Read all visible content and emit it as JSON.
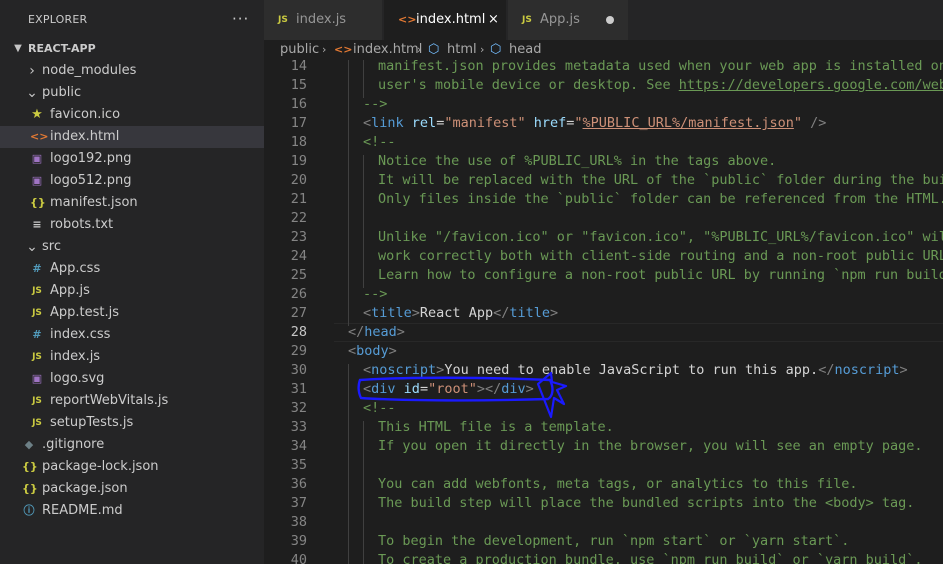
{
  "sidebar": {
    "title": "EXPLORER",
    "more": "···",
    "root": "REACT-APP",
    "items": [
      {
        "label": "node_modules",
        "icon": "chevron-right",
        "depth": 1
      },
      {
        "label": "public",
        "icon": "chevron-down",
        "depth": 1
      },
      {
        "label": "favicon.ico",
        "icon": "star-icon",
        "depth": 2
      },
      {
        "label": "index.html",
        "icon": "html-icon",
        "depth": 2,
        "selected": true
      },
      {
        "label": "logo192.png",
        "icon": "image-icon",
        "depth": 2
      },
      {
        "label": "logo512.png",
        "icon": "image-icon",
        "depth": 2
      },
      {
        "label": "manifest.json",
        "icon": "json-icon",
        "depth": 2
      },
      {
        "label": "robots.txt",
        "icon": "text-icon",
        "depth": 2
      },
      {
        "label": "src",
        "icon": "chevron-down",
        "depth": 1
      },
      {
        "label": "App.css",
        "icon": "css-icon",
        "depth": 2
      },
      {
        "label": "App.js",
        "icon": "js-icon",
        "depth": 2
      },
      {
        "label": "App.test.js",
        "icon": "js-icon",
        "depth": 2
      },
      {
        "label": "index.css",
        "icon": "css-icon",
        "depth": 2
      },
      {
        "label": "index.js",
        "icon": "js-icon",
        "depth": 2
      },
      {
        "label": "logo.svg",
        "icon": "image-icon",
        "depth": 2
      },
      {
        "label": "reportWebVitals.js",
        "icon": "js-icon",
        "depth": 2
      },
      {
        "label": "setupTests.js",
        "icon": "js-icon",
        "depth": 2
      },
      {
        "label": ".gitignore",
        "icon": "git-icon",
        "depth": 1
      },
      {
        "label": "package-lock.json",
        "icon": "json-icon",
        "depth": 1
      },
      {
        "label": "package.json",
        "icon": "json-icon",
        "depth": 1
      },
      {
        "label": "README.md",
        "icon": "info-icon",
        "depth": 1
      }
    ]
  },
  "tabs": [
    {
      "label": "index.js",
      "icon_text": "JS"
    },
    {
      "label": "index.html",
      "icon_text": "<>",
      "active": true,
      "close": "×"
    },
    {
      "label": "App.js",
      "icon_text": "JS",
      "modified": true
    }
  ],
  "breadcrumb": {
    "folder": "public",
    "file": "index.html",
    "node1": "html",
    "node2": "head"
  },
  "editor": {
    "current_line": 28,
    "lines": [
      {
        "n": 14,
        "indent": 2,
        "tokens": [
          {
            "t": "c",
            "v": "manifest.json provides metadata used when your web app is installed on a"
          }
        ]
      },
      {
        "n": 15,
        "indent": 2,
        "tokens": [
          {
            "t": "c",
            "v": "user's mobile device or desktop. See "
          },
          {
            "t": "cu",
            "v": "https://developers.google.com/web/fundamentals/web-app-manifest/"
          }
        ]
      },
      {
        "n": 16,
        "indent": 1,
        "tokens": [
          {
            "t": "c",
            "v": "-->"
          }
        ]
      },
      {
        "n": 17,
        "indent": 1,
        "tokens": [
          {
            "t": "p",
            "v": "<"
          },
          {
            "t": "tag",
            "v": "link"
          },
          {
            "t": "x",
            "v": " "
          },
          {
            "t": "a",
            "v": "rel"
          },
          {
            "t": "x",
            "v": "="
          },
          {
            "t": "s",
            "v": "\"manifest\""
          },
          {
            "t": "x",
            "v": " "
          },
          {
            "t": "a",
            "v": "href"
          },
          {
            "t": "x",
            "v": "="
          },
          {
            "t": "s",
            "v": "\""
          },
          {
            "t": "su",
            "v": "%PUBLIC_URL%/manifest.json"
          },
          {
            "t": "s",
            "v": "\""
          },
          {
            "t": "x",
            "v": " "
          },
          {
            "t": "p",
            "v": "/>"
          }
        ]
      },
      {
        "n": 18,
        "indent": 1,
        "tokens": [
          {
            "t": "c",
            "v": "<!--"
          }
        ]
      },
      {
        "n": 19,
        "indent": 2,
        "tokens": [
          {
            "t": "c",
            "v": "Notice the use of %PUBLIC_URL% in the tags above."
          }
        ]
      },
      {
        "n": 20,
        "indent": 2,
        "tokens": [
          {
            "t": "c",
            "v": "It will be replaced with the URL of the `public` folder during the build."
          }
        ]
      },
      {
        "n": 21,
        "indent": 2,
        "tokens": [
          {
            "t": "c",
            "v": "Only files inside the `public` folder can be referenced from the HTML."
          }
        ]
      },
      {
        "n": 22,
        "indent": 2,
        "tokens": []
      },
      {
        "n": 23,
        "indent": 2,
        "tokens": [
          {
            "t": "c",
            "v": "Unlike \"/favicon.ico\" or \"favicon.ico\", \"%PUBLIC_URL%/favicon.ico\" will"
          }
        ]
      },
      {
        "n": 24,
        "indent": 2,
        "tokens": [
          {
            "t": "c",
            "v": "work correctly both with client-side routing and a non-root public URL."
          }
        ]
      },
      {
        "n": 25,
        "indent": 2,
        "tokens": [
          {
            "t": "c",
            "v": "Learn how to configure a non-root public URL by running `npm run build`."
          }
        ]
      },
      {
        "n": 26,
        "indent": 1,
        "tokens": [
          {
            "t": "c",
            "v": "-->"
          }
        ]
      },
      {
        "n": 27,
        "indent": 1,
        "tokens": [
          {
            "t": "p",
            "v": "<"
          },
          {
            "t": "tag",
            "v": "title"
          },
          {
            "t": "p",
            "v": ">"
          },
          {
            "t": "x",
            "v": "React App"
          },
          {
            "t": "p",
            "v": "</"
          },
          {
            "t": "tag",
            "v": "title"
          },
          {
            "t": "p",
            "v": ">"
          }
        ]
      },
      {
        "n": 28,
        "indent": 0,
        "tokens": [
          {
            "t": "p",
            "v": "</"
          },
          {
            "t": "tag",
            "v": "head"
          },
          {
            "t": "p",
            "v": ">"
          }
        ]
      },
      {
        "n": 29,
        "indent": 0,
        "tokens": [
          {
            "t": "p",
            "v": "<"
          },
          {
            "t": "tag",
            "v": "body"
          },
          {
            "t": "p",
            "v": ">"
          }
        ]
      },
      {
        "n": 30,
        "indent": 1,
        "tokens": [
          {
            "t": "p",
            "v": "<"
          },
          {
            "t": "tag",
            "v": "noscript"
          },
          {
            "t": "p",
            "v": ">"
          },
          {
            "t": "x",
            "v": "You need to enable JavaScript to run this app."
          },
          {
            "t": "p",
            "v": "</"
          },
          {
            "t": "tag",
            "v": "noscript"
          },
          {
            "t": "p",
            "v": ">"
          }
        ]
      },
      {
        "n": 31,
        "indent": 1,
        "tokens": [
          {
            "t": "p",
            "v": "<"
          },
          {
            "t": "tag",
            "v": "div"
          },
          {
            "t": "x",
            "v": " "
          },
          {
            "t": "a",
            "v": "id"
          },
          {
            "t": "x",
            "v": "="
          },
          {
            "t": "s",
            "v": "\"root\""
          },
          {
            "t": "p",
            "v": "></"
          },
          {
            "t": "tag",
            "v": "div"
          },
          {
            "t": "p",
            "v": ">"
          }
        ]
      },
      {
        "n": 32,
        "indent": 1,
        "tokens": [
          {
            "t": "c",
            "v": "<!--"
          }
        ]
      },
      {
        "n": 33,
        "indent": 2,
        "tokens": [
          {
            "t": "c",
            "v": "This HTML file is a template."
          }
        ]
      },
      {
        "n": 34,
        "indent": 2,
        "tokens": [
          {
            "t": "c",
            "v": "If you open it directly in the browser, you will see an empty page."
          }
        ]
      },
      {
        "n": 35,
        "indent": 2,
        "tokens": []
      },
      {
        "n": 36,
        "indent": 2,
        "tokens": [
          {
            "t": "c",
            "v": "You can add webfonts, meta tags, or analytics to this file."
          }
        ]
      },
      {
        "n": 37,
        "indent": 2,
        "tokens": [
          {
            "t": "c",
            "v": "The build step will place the bundled scripts into the <body> tag."
          }
        ]
      },
      {
        "n": 38,
        "indent": 2,
        "tokens": []
      },
      {
        "n": 39,
        "indent": 2,
        "tokens": [
          {
            "t": "c",
            "v": "To begin the development, run `npm start` or `yarn start`."
          }
        ]
      },
      {
        "n": 40,
        "indent": 2,
        "tokens": [
          {
            "t": "c",
            "v": "To create a production bundle, use `npm run build` or `yarn build`."
          }
        ]
      }
    ]
  },
  "colors": {
    "annotation": "#1a1aff",
    "tag": "#569cd6",
    "attribute": "#9cdcfe",
    "string": "#ce9178",
    "comment": "#6a9955"
  }
}
